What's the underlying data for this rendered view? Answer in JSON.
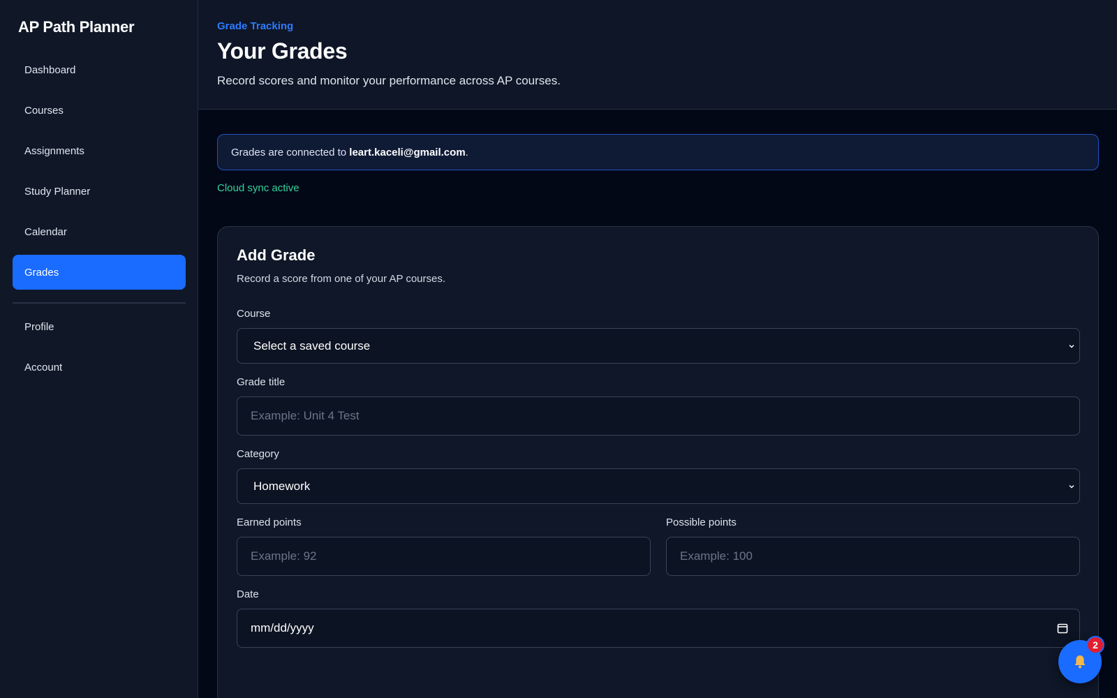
{
  "app": {
    "title": "AP Path Planner"
  },
  "sidebar": {
    "items": [
      {
        "label": "Dashboard"
      },
      {
        "label": "Courses"
      },
      {
        "label": "Assignments"
      },
      {
        "label": "Study Planner"
      },
      {
        "label": "Calendar"
      },
      {
        "label": "Grades",
        "active": true
      }
    ],
    "secondary": [
      {
        "label": "Profile"
      },
      {
        "label": "Account"
      }
    ]
  },
  "header": {
    "eyebrow": "Grade Tracking",
    "title": "Your Grades",
    "subtitle": "Record scores and monitor your performance across AP courses."
  },
  "notice": {
    "prefix": "Grades are connected to ",
    "email": "leart.kaceli@gmail.com",
    "suffix": "."
  },
  "sync_status": "Cloud sync active",
  "form": {
    "title": "Add Grade",
    "subtitle": "Record a score from one of your AP courses.",
    "course": {
      "label": "Course",
      "value": "Select a saved course"
    },
    "grade_title": {
      "label": "Grade title",
      "placeholder": "Example: Unit 4 Test"
    },
    "category": {
      "label": "Category",
      "value": "Homework"
    },
    "earned": {
      "label": "Earned points",
      "placeholder": "Example: 92"
    },
    "possible": {
      "label": "Possible points",
      "placeholder": "Example: 100"
    },
    "date": {
      "label": "Date",
      "value": "mm/dd/yyyy"
    }
  },
  "notifications": {
    "count": "2",
    "icon": "bell-icon"
  },
  "colors": {
    "accent": "#1a6bff",
    "success": "#34d399",
    "badge": "#e11d2e"
  }
}
